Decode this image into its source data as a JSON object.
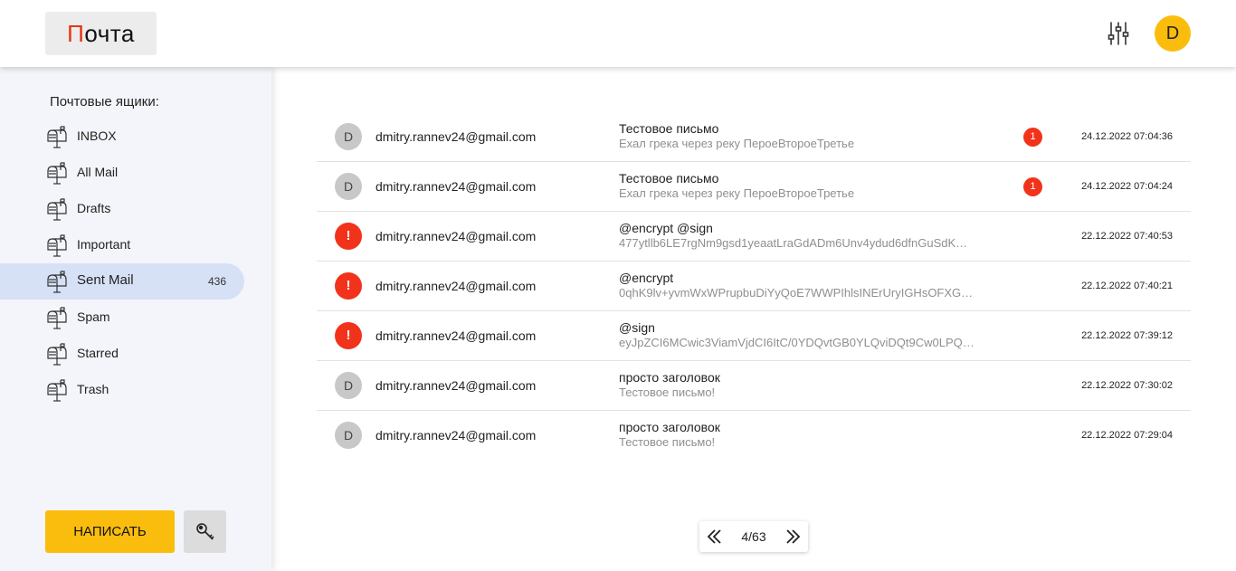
{
  "header": {
    "logo_first": "П",
    "logo_rest": "очта",
    "avatar_letter": "D",
    "settings_icon": "sliders-icon"
  },
  "sidebar": {
    "title": "Почтовые ящики:",
    "mailboxes": [
      {
        "label": "INBOX",
        "count": "",
        "active": false
      },
      {
        "label": "All Mail",
        "count": "",
        "active": false
      },
      {
        "label": "Drafts",
        "count": "",
        "active": false
      },
      {
        "label": "Important",
        "count": "",
        "active": false
      },
      {
        "label": "Sent Mail",
        "count": "436",
        "active": true
      },
      {
        "label": "Spam",
        "count": "",
        "active": false
      },
      {
        "label": "Starred",
        "count": "",
        "active": false
      },
      {
        "label": "Trash",
        "count": "",
        "active": false
      }
    ],
    "compose_label": "НАПИСАТЬ",
    "key_icon": "key-icon"
  },
  "mails": [
    {
      "avatar": "D",
      "warn": false,
      "sender": "dmitry.rannev24@gmail.com",
      "subject": "Тестовое письмо",
      "preview": "Ехал грека через реку ПероеВтороеТретье",
      "badge": "1",
      "date": "24.12.2022 07:04:36"
    },
    {
      "avatar": "D",
      "warn": false,
      "sender": "dmitry.rannev24@gmail.com",
      "subject": "Тестовое письмо",
      "preview": "Ехал грека через реку ПероеВтороеТретье",
      "badge": "1",
      "date": "24.12.2022 07:04:24"
    },
    {
      "avatar": "!",
      "warn": true,
      "sender": "dmitry.rannev24@gmail.com",
      "subject": "@encrypt @sign",
      "preview": "477ytllb6LE7rgNm9gsd1yeaatLraGdADm6Unv4ydud6dfnGuSdK…",
      "badge": "",
      "date": "22.12.2022 07:40:53"
    },
    {
      "avatar": "!",
      "warn": true,
      "sender": "dmitry.rannev24@gmail.com",
      "subject": "@encrypt",
      "preview": "0qhK9lv+yvmWxWPrupbuDiYyQoE7WWPIhlsINErUryIGHsOFXG…",
      "badge": "",
      "date": "22.12.2022 07:40:21"
    },
    {
      "avatar": "!",
      "warn": true,
      "sender": "dmitry.rannev24@gmail.com",
      "subject": "@sign",
      "preview": "eyJpZCI6MCwic3ViamVjdCI6ItC/0YDQvtGB0YLQviDQt9Cw0LPQ…",
      "badge": "",
      "date": "22.12.2022 07:39:12"
    },
    {
      "avatar": "D",
      "warn": false,
      "sender": "dmitry.rannev24@gmail.com",
      "subject": "просто заголовок",
      "preview": "Тестовое письмо!",
      "badge": "",
      "date": "22.12.2022 07:30:02"
    },
    {
      "avatar": "D",
      "warn": false,
      "sender": "dmitry.rannev24@gmail.com",
      "subject": "просто заголовок",
      "preview": "Тестовое письмо!",
      "badge": "",
      "date": "22.12.2022 07:29:04"
    }
  ],
  "pager": {
    "page": "4/63",
    "prev_icon": "double-chevron-left-icon",
    "next_icon": "double-chevron-right-icon"
  },
  "colors": {
    "accent": "#fbbd0d",
    "alert": "#f2331b",
    "active_mailbox": "#d6e1f6",
    "sidebar_bg": "#f3f5fa"
  }
}
